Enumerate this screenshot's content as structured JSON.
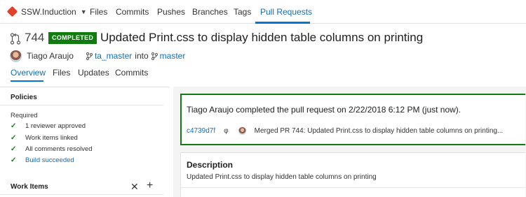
{
  "nav": {
    "repo": "SSW.Induction",
    "items": [
      "Files",
      "Commits",
      "Pushes",
      "Branches",
      "Tags",
      "Pull Requests"
    ],
    "active": "Pull Requests"
  },
  "pr": {
    "id": "744",
    "status": "COMPLETED",
    "title": "Updated Print.css to display hidden table columns on printing",
    "author": "Tiago Araujo",
    "source_branch": "ta_master",
    "into": "into",
    "target_branch": "master"
  },
  "tabs": [
    "Overview",
    "Files",
    "Updates",
    "Commits"
  ],
  "policies": {
    "title": "Policies",
    "required_label": "Required",
    "items": [
      {
        "label": "1 reviewer approved",
        "link": false
      },
      {
        "label": "Work items linked",
        "link": false
      },
      {
        "label": "All comments resolved",
        "link": false
      },
      {
        "label": "Build succeeded",
        "link": true
      }
    ]
  },
  "work_items": {
    "title": "Work Items"
  },
  "completion": {
    "message": "Tiago Araujo completed the pull request on 2/22/2018 6:12 PM (just now).",
    "commit_id": "c4739d7f",
    "commit_message": "Merged PR 744: Updated Print.css to display hidden table columns on printing..."
  },
  "description": {
    "title": "Description",
    "text": "Updated Print.css to display hidden table columns on printing"
  },
  "colors": {
    "accent": "#0078d4",
    "link": "#106ebe",
    "success": "#107c10",
    "repo_logo": "#e3402b"
  },
  "icons": [
    "repo-logo-icon",
    "chevron-down-icon",
    "pull-request-icon",
    "branch-icon",
    "check-icon",
    "commit-icon",
    "close-icon",
    "add-icon"
  ]
}
